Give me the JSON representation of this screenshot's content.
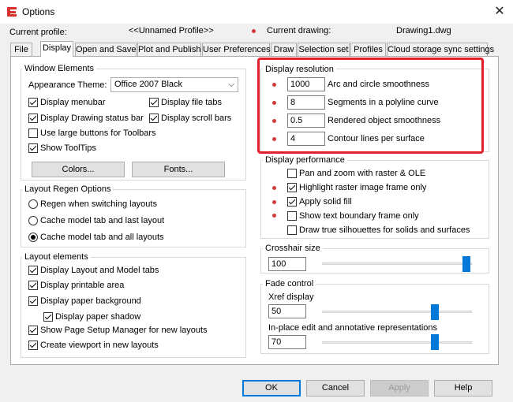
{
  "window": {
    "title": "Options"
  },
  "profile": {
    "current_profile_label": "Current profile:",
    "current_profile_value": "<<Unnamed Profile>>",
    "current_drawing_label": "Current drawing:",
    "current_drawing_value": "Drawing1.dwg"
  },
  "tabs": [
    {
      "label": "File"
    },
    {
      "label": "Display"
    },
    {
      "label": "Open and Save"
    },
    {
      "label": "Plot and Publish"
    },
    {
      "label": "User Preferences"
    },
    {
      "label": "Draw"
    },
    {
      "label": "Selection set"
    },
    {
      "label": "Profiles"
    },
    {
      "label": "Cloud storage sync settings"
    }
  ],
  "window_elements": {
    "title": "Window Elements",
    "theme_label": "Appearance Theme:",
    "theme_value": "Office 2007 Black",
    "menubar": "Display menubar",
    "file_tabs": "Display file tabs",
    "drawing_status_bar": "Display Drawing status bar",
    "scroll_bars": "Display scroll bars",
    "large_buttons": "Use large buttons for Toolbars",
    "tooltips": "Show ToolTips",
    "colors_button": "Colors...",
    "fonts_button": "Fonts..."
  },
  "layout_regen": {
    "title": "Layout Regen Options",
    "option1": "Regen when switching layouts",
    "option2": "Cache model tab and last layout",
    "option3": "Cache model tab and all layouts"
  },
  "layout_elements": {
    "title": "Layout elements",
    "item1": "Display Layout and Model tabs",
    "item2": "Display printable area",
    "item3": "Display paper background",
    "item4": "Display paper shadow",
    "item5": "Show Page Setup Manager for new layouts",
    "item6": "Create viewport in new layouts"
  },
  "display_resolution": {
    "title": "Display resolution",
    "rows": [
      {
        "value": "1000",
        "label": "Arc and circle smoothness"
      },
      {
        "value": "8",
        "label": "Segments in a polyline curve"
      },
      {
        "value": "0.5",
        "label": "Rendered object smoothness"
      },
      {
        "value": "4",
        "label": "Contour lines per surface"
      }
    ]
  },
  "display_performance": {
    "title": "Display performance",
    "item1": "Pan and zoom with raster & OLE",
    "item2": "Highlight raster image frame only",
    "item3": "Apply solid fill",
    "item4": "Show text boundary frame only",
    "item5": "Draw true silhouettes for solids and surfaces"
  },
  "crosshair": {
    "title": "Crosshair size",
    "value": "100",
    "level_pct": 100
  },
  "fade": {
    "title": "Fade control",
    "xref_label": "Xref display",
    "xref_value": "50",
    "inplace_label": "In-place edit and annotative representations",
    "inplace_value": "70"
  },
  "buttons": {
    "ok": "OK",
    "cancel": "Cancel",
    "apply": "Apply",
    "help": "Help"
  },
  "colors": {
    "accent": "#0078d7",
    "highlight": "#e0202a"
  }
}
